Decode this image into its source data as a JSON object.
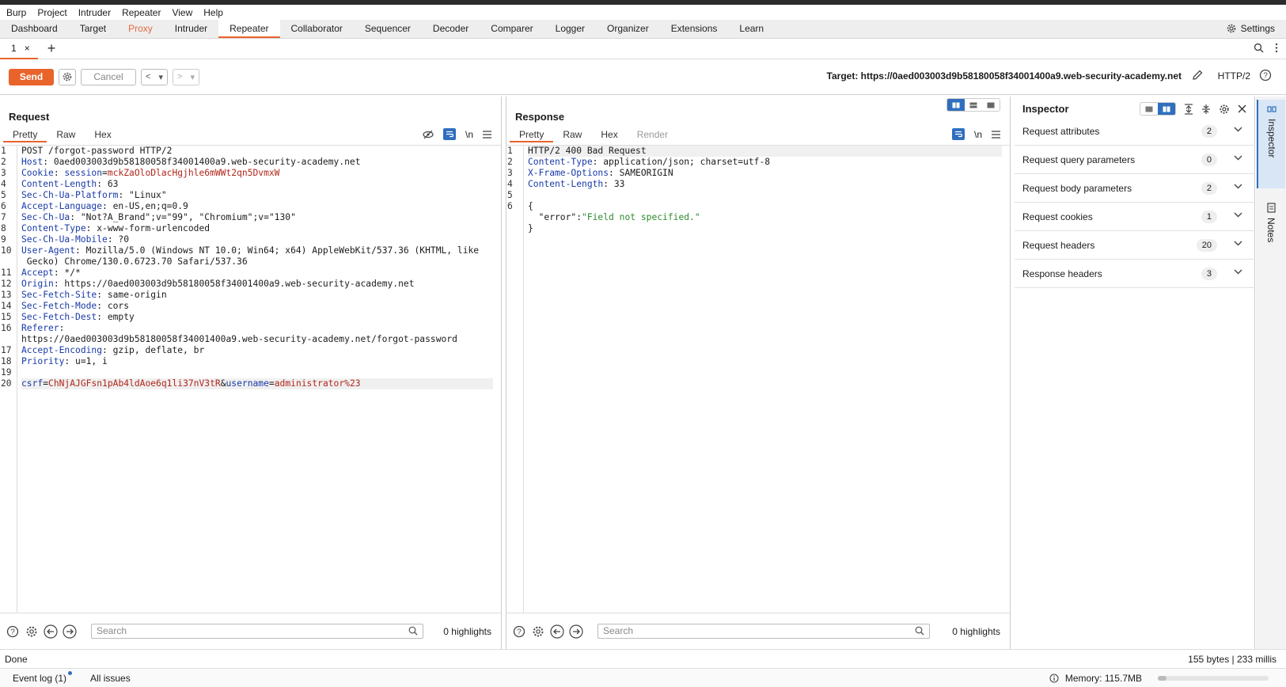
{
  "menu": [
    "Burp",
    "Project",
    "Intruder",
    "Repeater",
    "View",
    "Help"
  ],
  "tabs": [
    "Dashboard",
    "Target",
    "Proxy",
    "Intruder",
    "Repeater",
    "Collaborator",
    "Sequencer",
    "Decoder",
    "Comparer",
    "Logger",
    "Organizer",
    "Extensions",
    "Learn"
  ],
  "active_tab": "Repeater",
  "settings_label": "Settings",
  "subtab": {
    "label": "1",
    "close": "×",
    "add": "+"
  },
  "toolbar": {
    "send": "Send",
    "cancel": "Cancel",
    "target": "Target: https://0aed003003d9b58180058f34001400a9.web-security-academy.net",
    "protocol": "HTTP/2"
  },
  "request": {
    "title": "Request",
    "tabs": [
      "Pretty",
      "Raw",
      "Hex"
    ],
    "newline_label": "\\n",
    "line_numbers": [
      "1",
      "2",
      "3",
      "4",
      "5",
      "6",
      "7",
      "8",
      "9",
      "10",
      "",
      "11",
      "12",
      "13",
      "14",
      "15",
      "16",
      "",
      "17",
      "18",
      "19",
      "20"
    ],
    "lines": [
      {
        "n": "1",
        "parts": [
          [
            "POST /forgot-password HTTP/2",
            ""
          ]
        ]
      },
      {
        "n": "2",
        "parts": [
          [
            "Host",
            "k"
          ],
          [
            ": 0aed003003d9b58180058f34001400a9.web-security-academy.net",
            ""
          ]
        ]
      },
      {
        "n": "3",
        "parts": [
          [
            "Cookie",
            "k"
          ],
          [
            ": ",
            ""
          ],
          [
            "session",
            "k"
          ],
          [
            "=",
            ""
          ],
          [
            "mckZaOloDlacHgjhle6mWWt2qn5DvmxW",
            "v"
          ]
        ]
      },
      {
        "n": "4",
        "parts": [
          [
            "Content-Length",
            "k"
          ],
          [
            ": 63",
            ""
          ]
        ]
      },
      {
        "n": "5",
        "parts": [
          [
            "Sec-Ch-Ua-Platform",
            "k"
          ],
          [
            ": \"Linux\"",
            ""
          ]
        ]
      },
      {
        "n": "6",
        "parts": [
          [
            "Accept-Language",
            "k"
          ],
          [
            ": en-US,en;q=0.9",
            ""
          ]
        ]
      },
      {
        "n": "7",
        "parts": [
          [
            "Sec-Ch-Ua",
            "k"
          ],
          [
            ": \"Not?A_Brand\";v=\"99\", \"Chromium\";v=\"130\"",
            ""
          ]
        ]
      },
      {
        "n": "8",
        "parts": [
          [
            "Content-Type",
            "k"
          ],
          [
            ": x-www-form-urlencoded",
            ""
          ]
        ]
      },
      {
        "n": "9",
        "parts": [
          [
            "Sec-Ch-Ua-Mobile",
            "k"
          ],
          [
            ": ?0",
            ""
          ]
        ]
      },
      {
        "n": "10",
        "parts": [
          [
            "User-Agent",
            "k"
          ],
          [
            ": Mozilla/5.0 (Windows NT 10.0; Win64; x64) AppleWebKit/537.36 (KHTML, like",
            ""
          ]
        ]
      },
      {
        "n": "",
        "parts": [
          [
            " Gecko) Chrome/130.0.6723.70 Safari/537.36",
            ""
          ]
        ]
      },
      {
        "n": "11",
        "parts": [
          [
            "Accept",
            "k"
          ],
          [
            ": */*",
            ""
          ]
        ]
      },
      {
        "n": "12",
        "parts": [
          [
            "Origin",
            "k"
          ],
          [
            ": https://0aed003003d9b58180058f34001400a9.web-security-academy.net",
            ""
          ]
        ]
      },
      {
        "n": "13",
        "parts": [
          [
            "Sec-Fetch-Site",
            "k"
          ],
          [
            ": same-origin",
            ""
          ]
        ]
      },
      {
        "n": "14",
        "parts": [
          [
            "Sec-Fetch-Mode",
            "k"
          ],
          [
            ": cors",
            ""
          ]
        ]
      },
      {
        "n": "15",
        "parts": [
          [
            "Sec-Fetch-Dest",
            "k"
          ],
          [
            ": empty",
            ""
          ]
        ]
      },
      {
        "n": "16",
        "parts": [
          [
            "Referer",
            "k"
          ],
          [
            ":",
            ""
          ]
        ]
      },
      {
        "n": "",
        "parts": [
          [
            "https://0aed003003d9b58180058f34001400a9.web-security-academy.net/forgot-password",
            ""
          ]
        ]
      },
      {
        "n": "17",
        "parts": [
          [
            "Accept-Encoding",
            "k"
          ],
          [
            ": gzip, deflate, br",
            ""
          ]
        ]
      },
      {
        "n": "18",
        "parts": [
          [
            "Priority",
            "k"
          ],
          [
            ": u=1, i",
            ""
          ]
        ]
      },
      {
        "n": "19",
        "parts": [
          [
            "",
            ""
          ]
        ]
      },
      {
        "n": "20",
        "parts": [
          [
            "csrf",
            "k"
          ],
          [
            "=",
            ""
          ],
          [
            "ChNjAJGFsn1pAb4ldAoe6q1li37nV3tR",
            "v"
          ],
          [
            "&",
            ""
          ],
          [
            "username",
            "k"
          ],
          [
            "=",
            ""
          ],
          [
            "administrator%23",
            "v"
          ]
        ],
        "hl": true
      }
    ],
    "search_placeholder": "Search",
    "highlights": "0 highlights"
  },
  "response": {
    "title": "Response",
    "tabs": [
      "Pretty",
      "Raw",
      "Hex",
      "Render"
    ],
    "newline_label": "\\n",
    "lines": [
      {
        "n": "1",
        "parts": [
          [
            "HTTP/2 400 Bad Request",
            ""
          ]
        ],
        "hl": true
      },
      {
        "n": "2",
        "parts": [
          [
            "Content-Type",
            "k"
          ],
          [
            ": application/json; charset=utf-8",
            ""
          ]
        ]
      },
      {
        "n": "3",
        "parts": [
          [
            "X-Frame-Options",
            "k"
          ],
          [
            ": SAMEORIGIN",
            ""
          ]
        ]
      },
      {
        "n": "4",
        "parts": [
          [
            "Content-Length",
            "k"
          ],
          [
            ": 33",
            ""
          ]
        ]
      },
      {
        "n": "5",
        "parts": [
          [
            "",
            ""
          ]
        ]
      },
      {
        "n": "6",
        "parts": [
          [
            "{",
            ""
          ]
        ]
      },
      {
        "n": "",
        "parts": [
          [
            "  \"error\"",
            ""
          ],
          [
            ":",
            ""
          ],
          [
            "\"Field not specified.\"",
            "s"
          ]
        ]
      },
      {
        "n": "",
        "parts": [
          [
            "}",
            ""
          ]
        ]
      }
    ],
    "search_placeholder": "Search",
    "highlights": "0 highlights"
  },
  "inspector": {
    "title": "Inspector",
    "sections": [
      {
        "label": "Request attributes",
        "count": "2"
      },
      {
        "label": "Request query parameters",
        "count": "0"
      },
      {
        "label": "Request body parameters",
        "count": "2"
      },
      {
        "label": "Request cookies",
        "count": "1"
      },
      {
        "label": "Request headers",
        "count": "20"
      },
      {
        "label": "Response headers",
        "count": "3"
      }
    ]
  },
  "sidebar": {
    "inspector": "Inspector",
    "notes": "Notes"
  },
  "status": {
    "left": "Done",
    "right": "155 bytes | 233 millis"
  },
  "bottom": {
    "event_log": "Event log (1)",
    "all_issues": "All issues",
    "memory": "Memory: 115.7MB",
    "memory_fraction": 0.08
  },
  "colors": {
    "accent": "#e8642b",
    "blue": "#2f6fbe",
    "key": "#1a3aa8",
    "value": "#b1261b",
    "string": "#2e8b2e"
  }
}
